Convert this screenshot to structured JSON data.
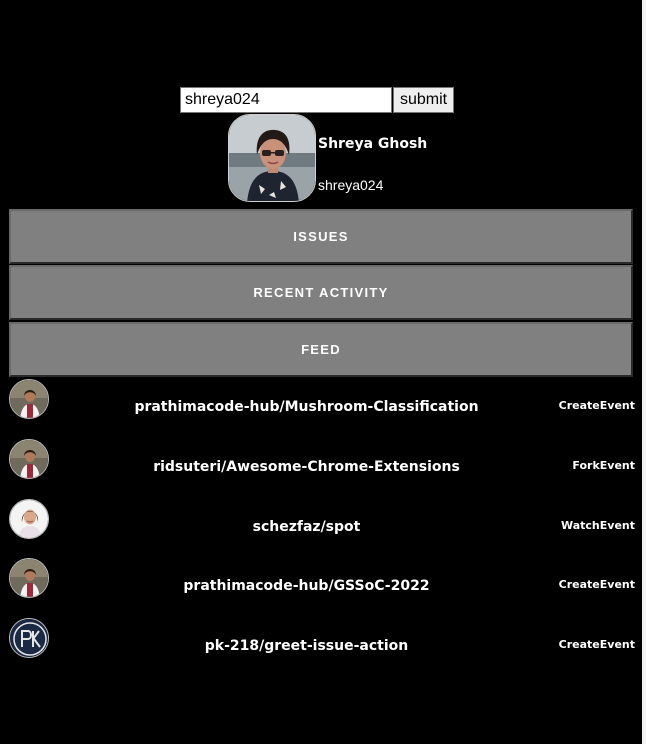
{
  "search": {
    "value": "shreya024",
    "submit_label": "submit"
  },
  "profile": {
    "name": "Shreya Ghosh",
    "login": "shreya024"
  },
  "tabs": [
    {
      "label": "ISSUES"
    },
    {
      "label": "RECENT ACTIVITY"
    },
    {
      "label": "FEED"
    }
  ],
  "feed": [
    {
      "repo": "prathimacode-hub/Mushroom-Classification",
      "type": "CreateEvent",
      "avatar": "avatar-woman-red-icon"
    },
    {
      "repo": "ridsuteri/Awesome-Chrome-Extensions",
      "type": "ForkEvent",
      "avatar": "avatar-woman-red-icon"
    },
    {
      "repo": "schezfaz/spot",
      "type": "WatchEvent",
      "avatar": "avatar-woman-light-icon"
    },
    {
      "repo": "prathimacode-hub/GSSoC-2022",
      "type": "CreateEvent",
      "avatar": "avatar-woman-red-icon"
    },
    {
      "repo": "pk-218/greet-issue-action",
      "type": "CreateEvent",
      "avatar": "pk-logo-icon"
    }
  ],
  "colors": {
    "background": "#000000",
    "tab_background": "#808080",
    "text": "#ffffff"
  }
}
